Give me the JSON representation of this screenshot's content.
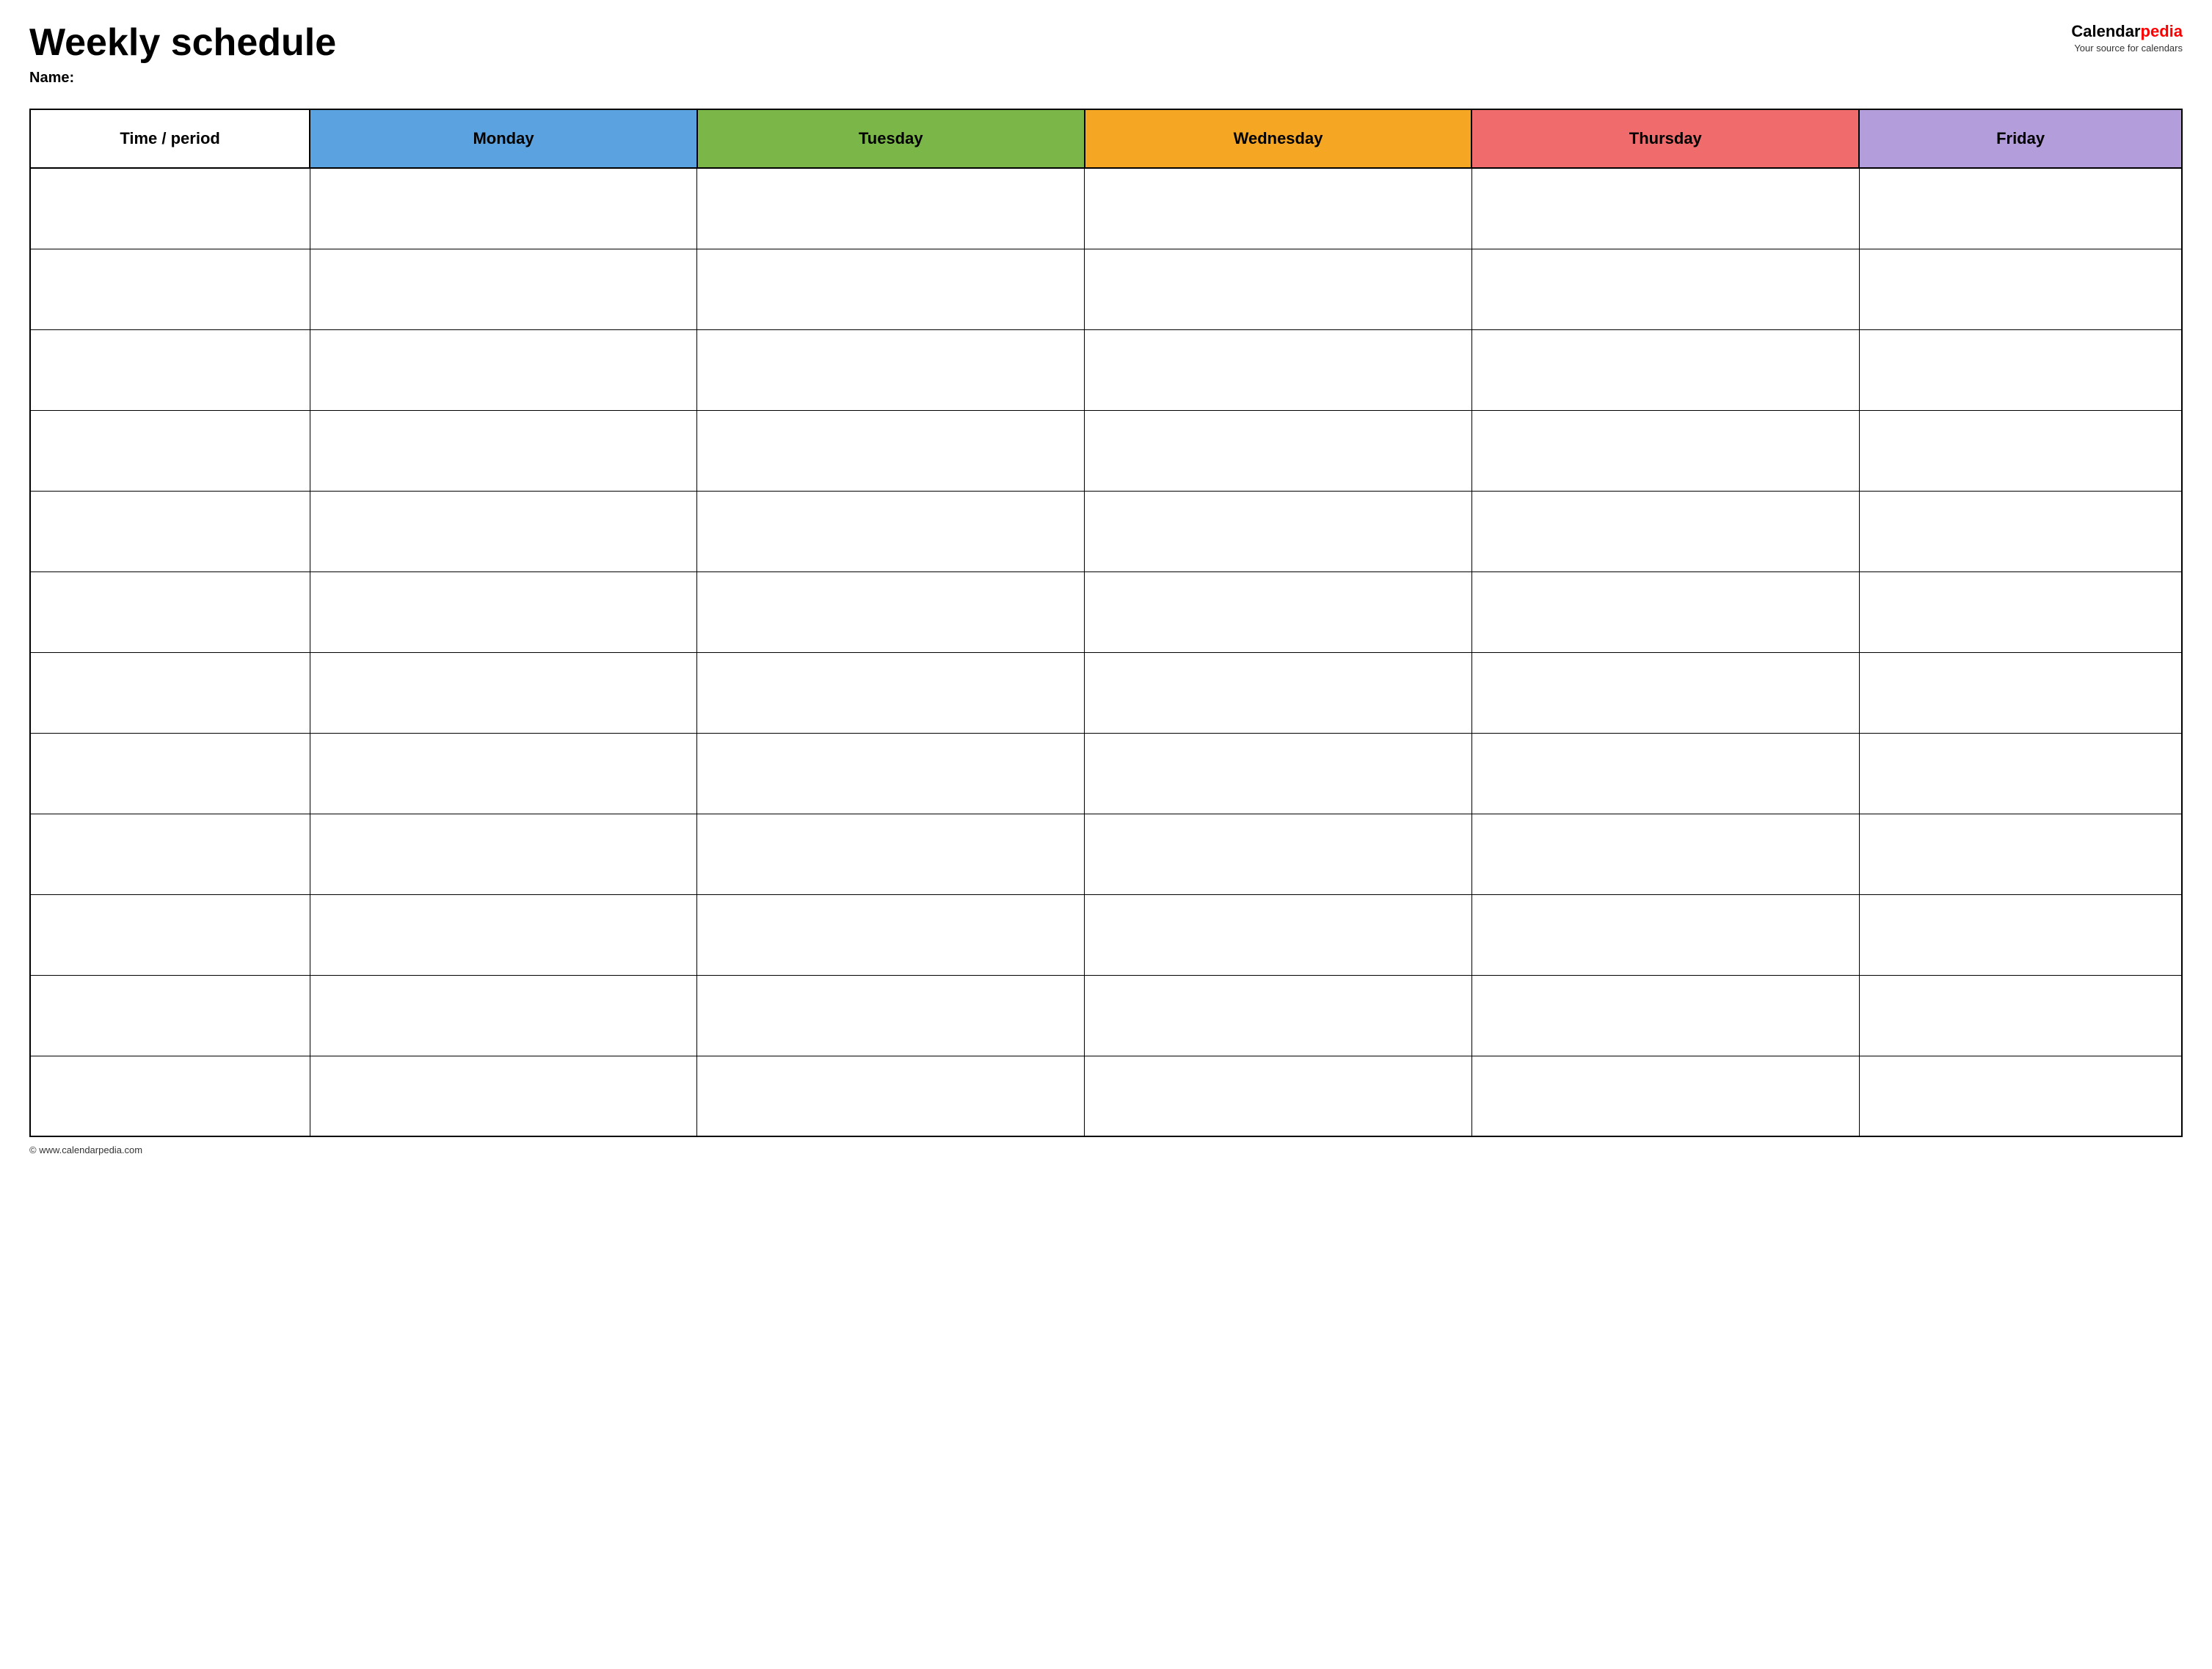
{
  "header": {
    "main_title": "Weekly schedule",
    "name_label": "Name:",
    "logo": {
      "calendar_text": "Calendar",
      "pedia_text": "pedia",
      "tagline": "Your source for calendars"
    }
  },
  "table": {
    "columns": [
      {
        "id": "time",
        "label": "Time / period",
        "color": "#ffffff",
        "text_color": "#000000"
      },
      {
        "id": "monday",
        "label": "Monday",
        "color": "#5ba3e0",
        "text_color": "#ffffff"
      },
      {
        "id": "tuesday",
        "label": "Tuesday",
        "color": "#7ab648",
        "text_color": "#ffffff"
      },
      {
        "id": "wednesday",
        "label": "Wednesday",
        "color": "#f5a623",
        "text_color": "#ffffff"
      },
      {
        "id": "thursday",
        "label": "Thursday",
        "color": "#f06b6b",
        "text_color": "#ffffff"
      },
      {
        "id": "friday",
        "label": "Friday",
        "color": "#b39ddb",
        "text_color": "#ffffff"
      }
    ],
    "row_count": 12
  },
  "footer": {
    "url": "© www.calendarpedia.com"
  }
}
